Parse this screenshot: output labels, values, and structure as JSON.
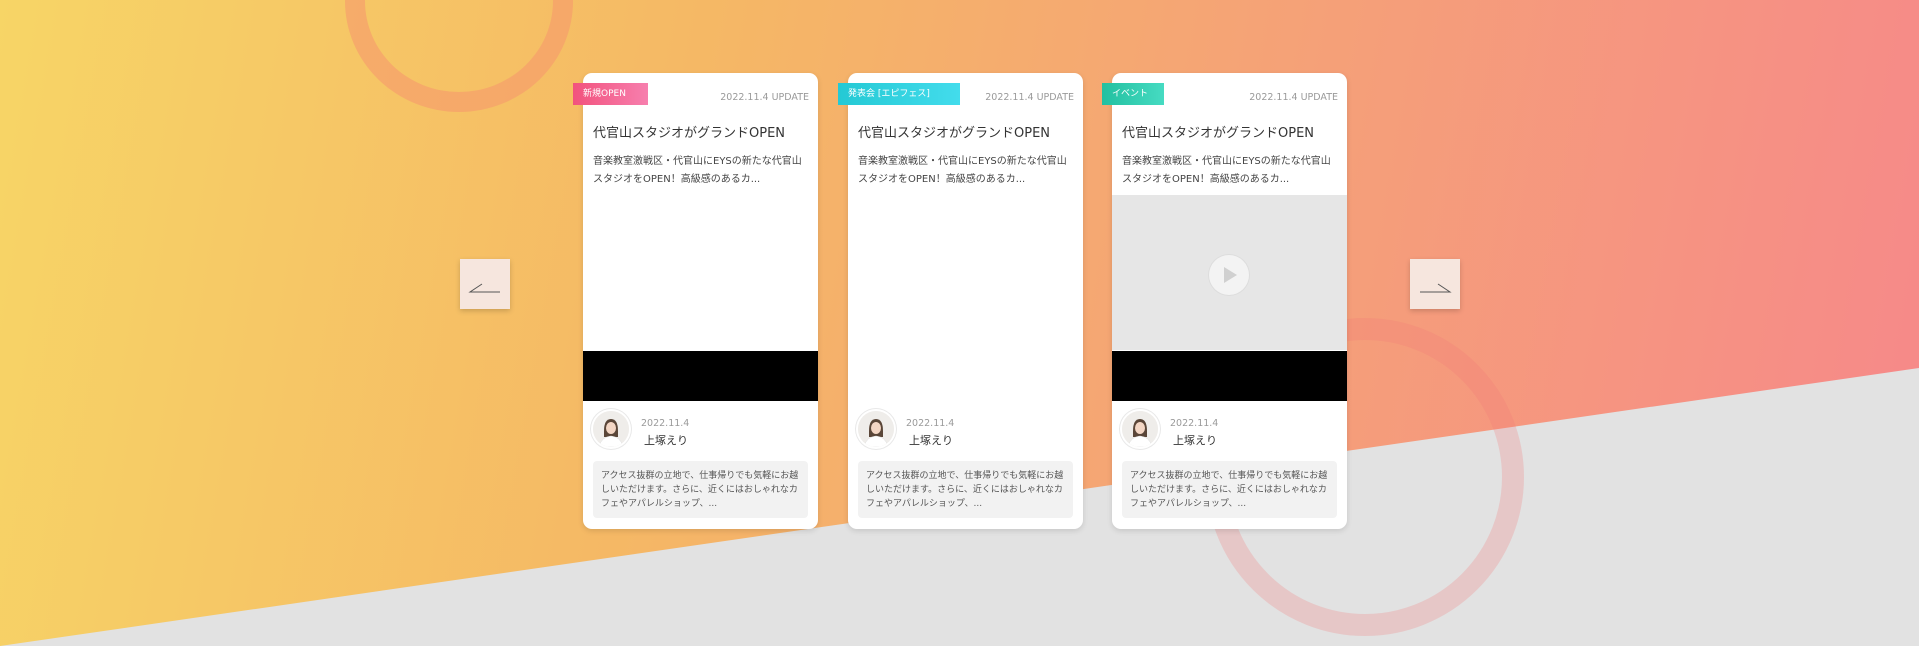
{
  "navigation": {
    "prev_icon": "arrow-left-icon",
    "next_icon": "arrow-right-icon"
  },
  "cards": [
    {
      "tag": "新規OPEN",
      "tag_color": "#f4608c",
      "update": "2022.11.4 UPDATE",
      "title": "代官山スタジオがグランドOPEN",
      "excerpt": "音楽教室激戦区・代官山にEYSの新たな代官山スタジオをOPEN！高級感のあるカ...",
      "media": "blank",
      "author_date": "2022.11.4",
      "author_name": "上塚えり",
      "comment": "アクセス抜群の立地で、仕事帰りでも気軽にお越しいただけます。さらに、近くにはおしゃれなカフェやアパレルショップ、..."
    },
    {
      "tag": "発表会 [エピフェス]",
      "tag_color": "#2fd0dc",
      "update": "2022.11.4 UPDATE",
      "title": "代官山スタジオがグランドOPEN",
      "excerpt": "音楽教室激戦区・代官山にEYSの新たな代官山スタジオをOPEN！高級感のあるカ...",
      "media": "blank",
      "author_date": "2022.11.4",
      "author_name": "上塚えり",
      "comment": "アクセス抜群の立地で、仕事帰りでも気軽にお越しいただけます。さらに、近くにはおしゃれなカフェやアパレルショップ、..."
    },
    {
      "tag": "イベント",
      "tag_color": "#2fc9ab",
      "update": "2022.11.4 UPDATE",
      "title": "代官山スタジオがグランドOPEN",
      "excerpt": "音楽教室激戦区・代官山にEYSの新たな代官山スタジオをOPEN！高級感のあるカ...",
      "media": "video",
      "author_date": "2022.11.4",
      "author_name": "上塚えり",
      "comment": "アクセス抜群の立地で、仕事帰りでも気軽にお越しいただけます。さらに、近くにはおしゃれなカフェやアパレルショップ、..."
    }
  ]
}
